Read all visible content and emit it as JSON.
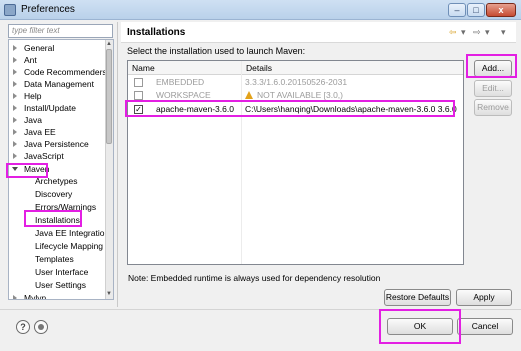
{
  "window": {
    "title": "Preferences",
    "min": "–",
    "max": "□",
    "close": "x"
  },
  "filter": {
    "placeholder": "type filter text"
  },
  "tree": {
    "items": [
      {
        "label": "General",
        "state": "closed"
      },
      {
        "label": "Ant",
        "state": "closed"
      },
      {
        "label": "Code Recommenders",
        "state": "closed"
      },
      {
        "label": "Data Management",
        "state": "closed"
      },
      {
        "label": "Help",
        "state": "closed"
      },
      {
        "label": "Install/Update",
        "state": "closed"
      },
      {
        "label": "Java",
        "state": "closed"
      },
      {
        "label": "Java EE",
        "state": "closed"
      },
      {
        "label": "Java Persistence",
        "state": "closed"
      },
      {
        "label": "JavaScript",
        "state": "closed"
      },
      {
        "label": "Maven",
        "state": "open"
      },
      {
        "label": "Archetypes",
        "state": "child"
      },
      {
        "label": "Discovery",
        "state": "child"
      },
      {
        "label": "Errors/Warnings",
        "state": "child"
      },
      {
        "label": "Installations",
        "state": "child"
      },
      {
        "label": "Java EE Integration",
        "state": "child"
      },
      {
        "label": "Lifecycle Mapping",
        "state": "child"
      },
      {
        "label": "Templates",
        "state": "child"
      },
      {
        "label": "User Interface",
        "state": "child"
      },
      {
        "label": "User Settings",
        "state": "child"
      },
      {
        "label": "Mylyn",
        "state": "closed"
      }
    ]
  },
  "page": {
    "title": "Installations",
    "instruction": "Select the installation used to launch Maven:",
    "columns": [
      "Name",
      "Details"
    ],
    "rows": [
      {
        "checked": false,
        "name": "EMBEDDED",
        "details": "3.3.3/1.6.0.20150526-2031",
        "muted": true,
        "warning": false
      },
      {
        "checked": false,
        "name": "WORKSPACE",
        "details": "NOT AVAILABLE [3.0,)",
        "muted": true,
        "warning": true
      },
      {
        "checked": true,
        "name": "apache-maven-3.6.0",
        "details": "C:\\Users\\hanqing\\Downloads\\apache-maven-3.6.0 3.6.0",
        "muted": false,
        "warning": false
      }
    ],
    "buttons": {
      "add": "Add...",
      "edit": "Edit...",
      "remove": "Remove"
    },
    "note": "Note: Embedded runtime is always used for dependency resolution",
    "restore_defaults": "Restore Defaults",
    "apply": "Apply"
  },
  "footer": {
    "ok": "OK",
    "cancel": "Cancel",
    "help": "?"
  },
  "colors": {
    "highlight": "#e31fe3",
    "titlebar": "#b9d1ea"
  }
}
